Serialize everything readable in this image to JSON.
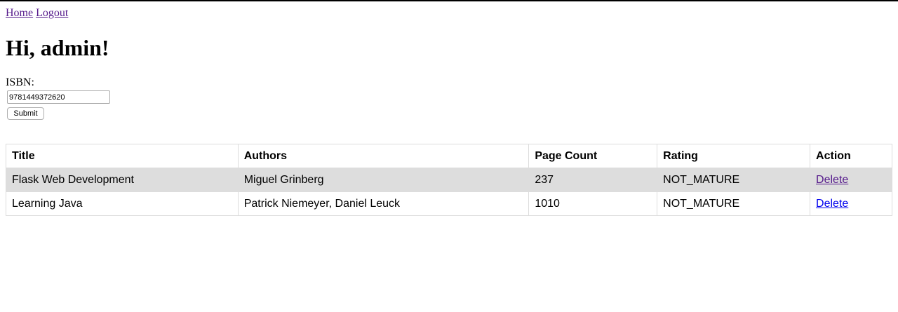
{
  "nav": {
    "home": "Home",
    "logout": "Logout"
  },
  "greeting": "Hi, admin!",
  "form": {
    "isbn_label": "ISBN:",
    "isbn_value": "9781449372620",
    "submit_label": "Submit"
  },
  "table": {
    "headers": [
      "Title",
      "Authors",
      "Page Count",
      "Rating",
      "Action"
    ],
    "rows": [
      {
        "title": "Flask Web Development",
        "authors": "Miguel Grinberg",
        "page_count": "237",
        "rating": "NOT_MATURE",
        "action": "Delete"
      },
      {
        "title": "Learning Java",
        "authors": "Patrick Niemeyer, Daniel Leuck",
        "page_count": "1010",
        "rating": "NOT_MATURE",
        "action": "Delete"
      }
    ]
  },
  "colors": {
    "visited_link": "#551a8b",
    "link": "#0000ee",
    "row_shade": "#dddddd",
    "border": "#dddddd"
  }
}
